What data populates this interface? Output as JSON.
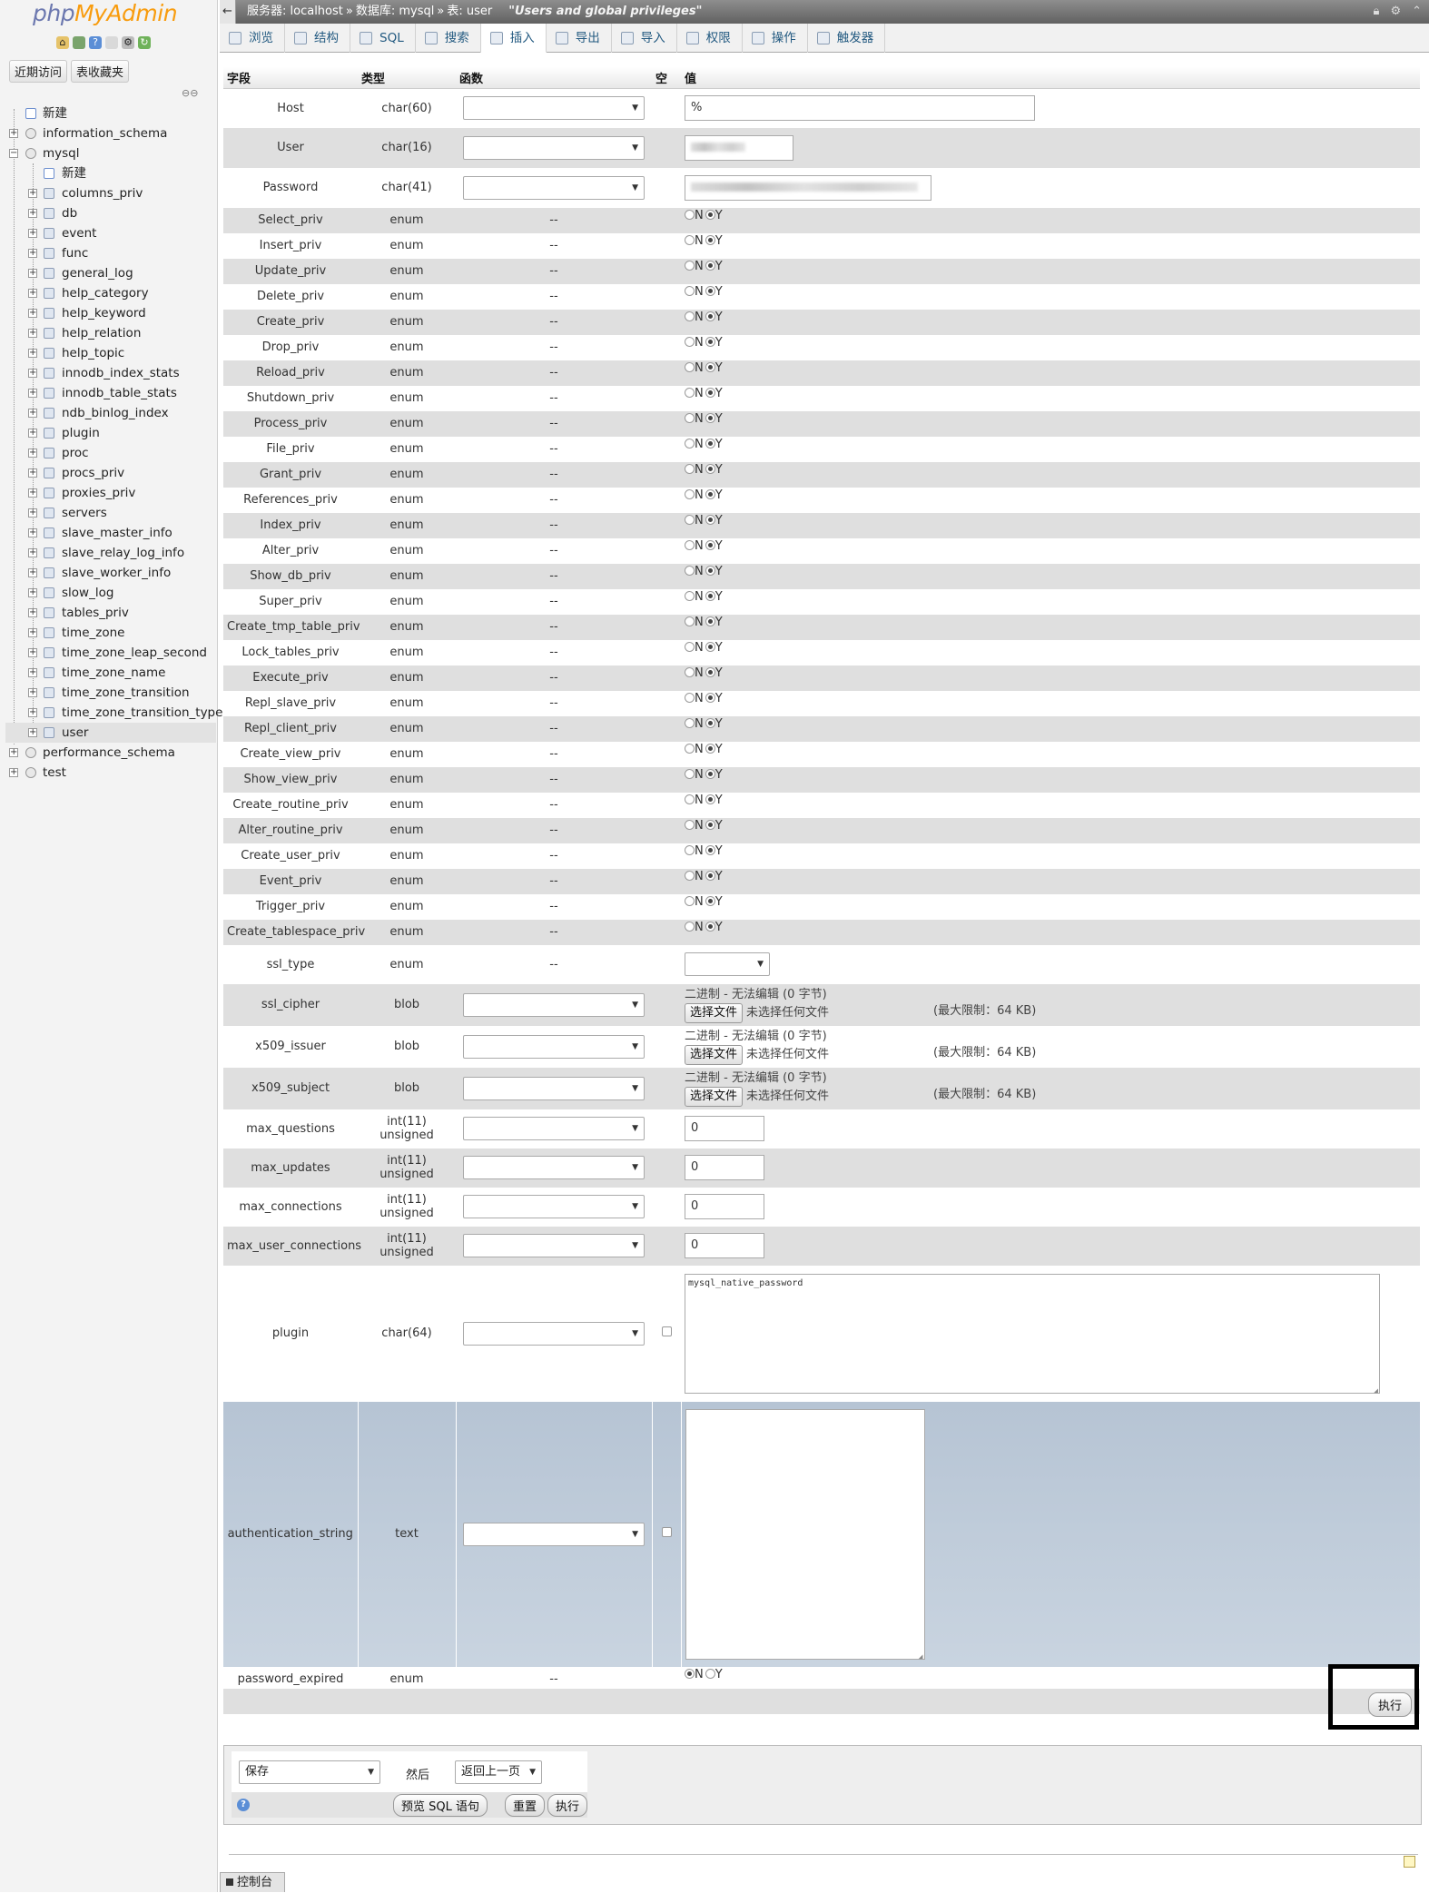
{
  "nav": {
    "logo_part1": "php",
    "logo_part2": "MyAdmin",
    "icons": [
      "home-icon",
      "sql-icon",
      "help-icon",
      "docs-icon",
      "settings-icon",
      "reload-icon"
    ],
    "tab_recent": "近期访问",
    "tab_favorites": "表收藏夹",
    "tree_root": [
      {
        "label": "新建",
        "type": "new"
      },
      {
        "label": "information_schema",
        "type": "db"
      },
      {
        "label": "mysql",
        "type": "db",
        "expanded": true
      }
    ],
    "mysql_children": [
      "新建",
      "columns_priv",
      "db",
      "event",
      "func",
      "general_log",
      "help_category",
      "help_keyword",
      "help_relation",
      "help_topic",
      "innodb_index_stats",
      "innodb_table_stats",
      "ndb_binlog_index",
      "plugin",
      "proc",
      "procs_priv",
      "proxies_priv",
      "servers",
      "slave_master_info",
      "slave_relay_log_info",
      "slave_worker_info",
      "slow_log",
      "tables_priv",
      "time_zone",
      "time_zone_leap_second",
      "time_zone_name",
      "time_zone_transition",
      "time_zone_transition_type",
      "user"
    ],
    "tree_after": [
      "performance_schema",
      "test"
    ]
  },
  "breadcrumb": {
    "server": "服务器: localhost",
    "database": "数据库: mysql",
    "table": "表: user",
    "comment": "\"Users and global privileges\""
  },
  "tabs": [
    "浏览",
    "结构",
    "SQL",
    "搜索",
    "插入",
    "导出",
    "导入",
    "权限",
    "操作",
    "触发器"
  ],
  "active_tab": "插入",
  "columns": {
    "field": "字段",
    "type": "类型",
    "function": "函数",
    "null": "空",
    "value": "值"
  },
  "rows_top": [
    {
      "name": "Host",
      "type": "char(60)",
      "value": "%"
    },
    {
      "name": "User",
      "type": "char(16)",
      "value": ""
    },
    {
      "name": "Password",
      "type": "char(41)",
      "value": ""
    }
  ],
  "priv_function": "--",
  "priv_type": "enum",
  "radio_n": "N",
  "radio_y": "Y",
  "privs": [
    "Select_priv",
    "Insert_priv",
    "Update_priv",
    "Delete_priv",
    "Create_priv",
    "Drop_priv",
    "Reload_priv",
    "Shutdown_priv",
    "Process_priv",
    "File_priv",
    "Grant_priv",
    "References_priv",
    "Index_priv",
    "Alter_priv",
    "Show_db_priv",
    "Super_priv",
    "Create_tmp_table_priv",
    "Lock_tables_priv",
    "Execute_priv",
    "Repl_slave_priv",
    "Repl_client_priv",
    "Create_view_priv",
    "Show_view_priv",
    "Create_routine_priv",
    "Alter_routine_priv",
    "Create_user_priv",
    "Event_priv",
    "Trigger_priv",
    "Create_tablespace_priv"
  ],
  "ssl_type": {
    "name": "ssl_type",
    "type": "enum",
    "function": "--"
  },
  "blob_rows": [
    {
      "name": "ssl_cipher",
      "type": "blob"
    },
    {
      "name": "x509_issuer",
      "type": "blob"
    },
    {
      "name": "x509_subject",
      "type": "blob"
    }
  ],
  "blob_text": {
    "note": "二进制 - 无法编辑 (0 字节)",
    "choose": "选择文件",
    "nofile": "未选择任何文件",
    "limit": "(最大限制：64 KB)"
  },
  "int_rows": [
    {
      "name": "max_questions",
      "type": "int(11) unsigned",
      "value": "0"
    },
    {
      "name": "max_updates",
      "type": "int(11) unsigned",
      "value": "0"
    },
    {
      "name": "max_connections",
      "type": "int(11) unsigned",
      "value": "0"
    },
    {
      "name": "max_user_connections",
      "type": "int(11) unsigned",
      "value": "0"
    }
  ],
  "plugin_row": {
    "name": "plugin",
    "type": "char(64)",
    "value": "mysql_native_password"
  },
  "auth_row": {
    "name": "authentication_string",
    "type": "text",
    "value": ""
  },
  "expired_row": {
    "name": "password_expired",
    "type": "enum",
    "function": "--"
  },
  "exec_label": "执行",
  "bottom": {
    "save_option": "保存",
    "then": "然后",
    "after_option": "返回上一页",
    "preview": "预览 SQL 语句",
    "reset": "重置",
    "go": "执行"
  },
  "console": "控制台"
}
